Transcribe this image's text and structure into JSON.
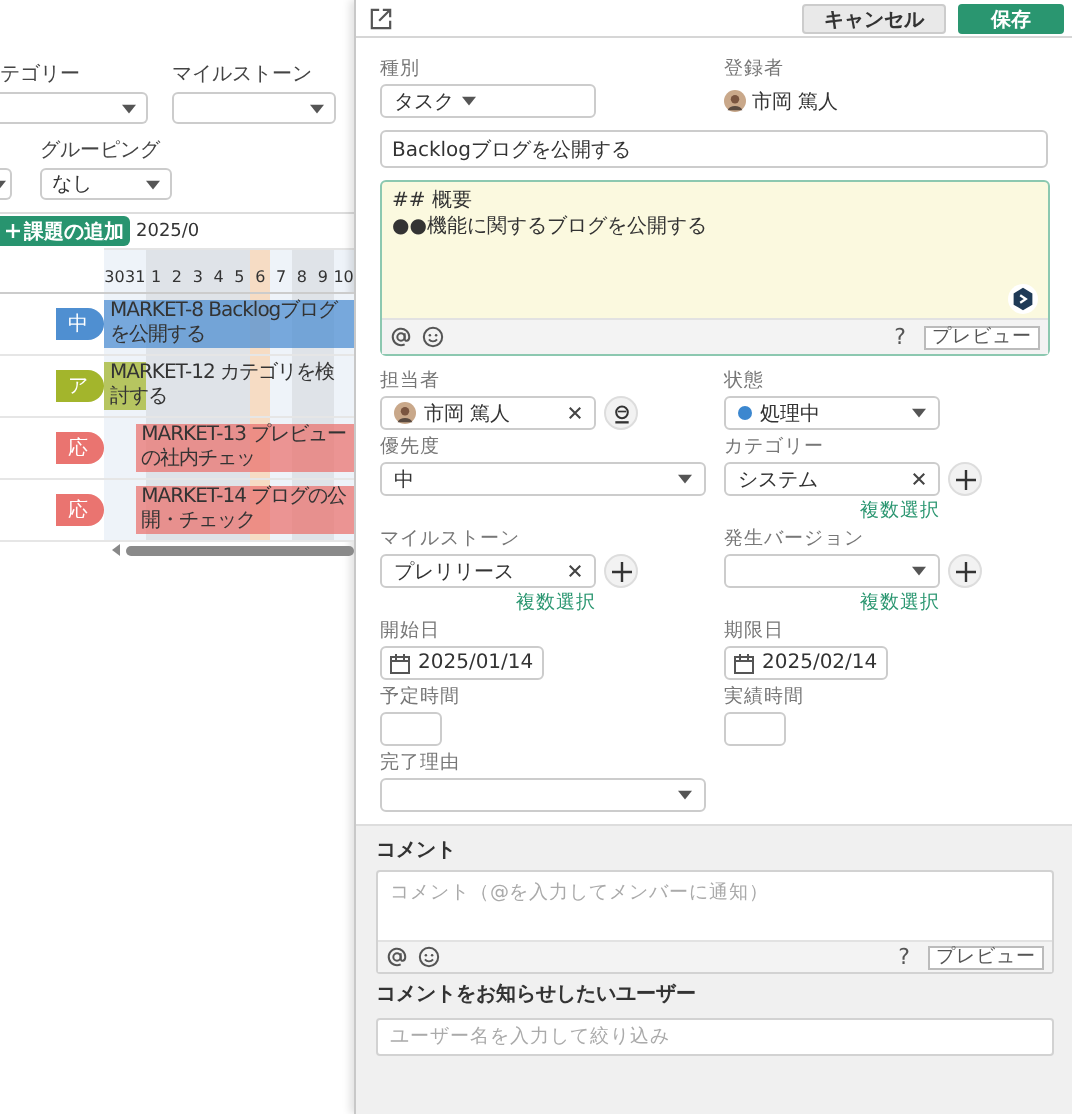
{
  "filters": {
    "category_label": "テゴリー",
    "milestone_label": "マイルストーン",
    "grouping_label": "グルーピング",
    "grouping_value": "なし"
  },
  "gantt": {
    "add_button": "課題の追加",
    "month": "2025/0",
    "days": [
      {
        "label": "30",
        "kind": "day"
      },
      {
        "label": "31",
        "kind": "day"
      },
      {
        "label": "1",
        "kind": "holiday"
      },
      {
        "label": "2",
        "kind": "holiday"
      },
      {
        "label": "3",
        "kind": "holiday"
      },
      {
        "label": "4",
        "kind": "holiday"
      },
      {
        "label": "5",
        "kind": "holiday"
      },
      {
        "label": "6",
        "kind": "today"
      },
      {
        "label": "7",
        "kind": "day"
      },
      {
        "label": "8",
        "kind": "holiday"
      },
      {
        "label": "9",
        "kind": "holiday"
      },
      {
        "label": "10",
        "kind": "day"
      }
    ],
    "rows": [
      {
        "status": "中",
        "color": "#4f8fd1",
        "kind": "span",
        "title": "MARKET-8  Backlogブログを公開する"
      },
      {
        "status": "ア",
        "color": "#a3b52c",
        "kind": "short",
        "title": "MARKET-12  カテゴリを検討する"
      },
      {
        "status": "応",
        "color": "#ea7470",
        "kind": "offset",
        "title": "MARKET-13  プレビューの社内チェッ"
      },
      {
        "status": "応",
        "color": "#ea7470",
        "kind": "offset",
        "title": "MARKET-14  ブログの公開・チェック"
      }
    ]
  },
  "editor": {
    "cancel": "キャンセル",
    "save": "保存",
    "type": {
      "label": "種別",
      "value": "タスク"
    },
    "registrant": {
      "label": "登録者",
      "name": "市岡 篤人"
    },
    "title": "Backlogブログを公開する",
    "description": {
      "lines": [
        "## 概要",
        "●●機能に関するブログを公開する"
      ],
      "help": "?",
      "preview": "プレビュー"
    },
    "fields": [
      {
        "kind": "user",
        "label": "担当者",
        "value": "市岡 篤人",
        "clearable": true,
        "assign_button": true
      },
      {
        "kind": "status",
        "label": "状態",
        "value": "処理中",
        "color": "#3c87cf"
      },
      {
        "kind": "select",
        "label": "優先度",
        "value": "中"
      },
      {
        "kind": "tag-select",
        "label": "カテゴリー",
        "value": "システム",
        "clearable": true,
        "add_button": true,
        "multi_select": "複数選択"
      },
      {
        "kind": "tag-select",
        "label": "マイルストーン",
        "value": "プレリリース",
        "clearable": true,
        "add_button": true,
        "multi_select": "複数選択"
      },
      {
        "kind": "tag-select",
        "label": "発生バージョン",
        "clearable": false,
        "add_button": true,
        "multi_select": "複数選択"
      },
      {
        "kind": "date",
        "label": "開始日",
        "value": "2025/01/14"
      },
      {
        "kind": "date",
        "label": "期限日",
        "value": "2025/02/14"
      },
      {
        "kind": "number",
        "label": "予定時間"
      },
      {
        "kind": "number",
        "label": "実績時間"
      },
      {
        "kind": "select",
        "label": "完了理由"
      }
    ]
  },
  "comment": {
    "title": "コメント",
    "placeholder": "コメント（@を入力してメンバーに通知）",
    "help": "?",
    "preview": "プレビュー",
    "notify_title": "コメントをお知らせしたいユーザー",
    "notify_placeholder": "ユーザー名を入力して絞り込み"
  }
}
